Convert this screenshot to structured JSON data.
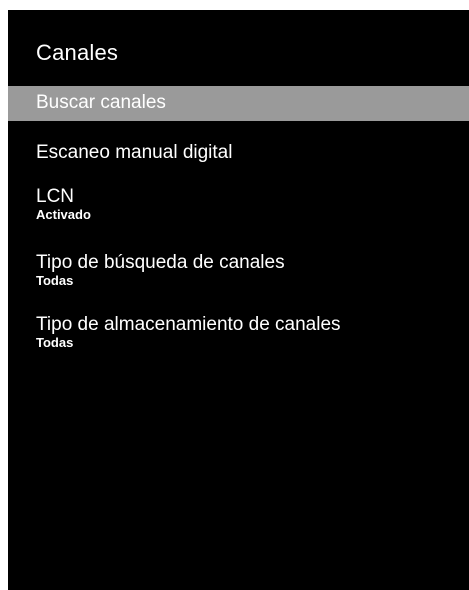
{
  "menu": {
    "title": "Canales",
    "items": [
      {
        "label": "Buscar canales",
        "selected": true
      },
      {
        "label": "Escaneo manual digital"
      },
      {
        "label": "LCN",
        "value": "Activado"
      },
      {
        "label": "Tipo de búsqueda de canales",
        "value": "Todas"
      },
      {
        "label": "Tipo de almacenamiento de canales",
        "value": "Todas"
      }
    ]
  },
  "colors": {
    "background": "#000000",
    "text": "#ffffff",
    "highlight": "#9a9a9a"
  }
}
